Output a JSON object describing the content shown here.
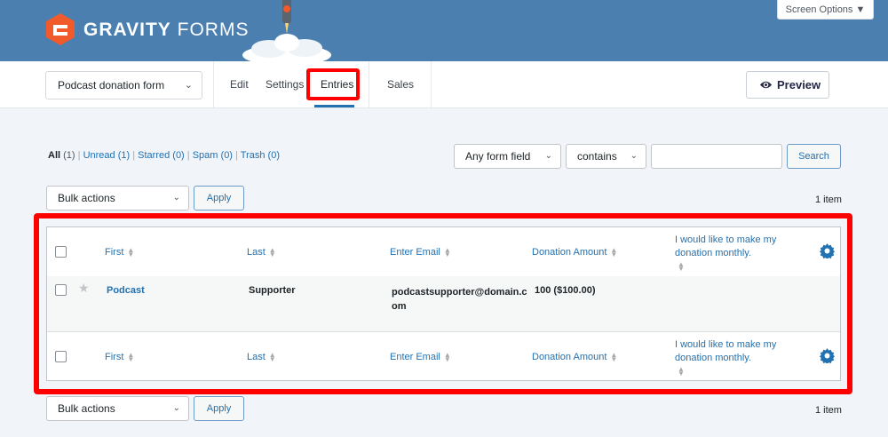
{
  "header": {
    "brand_bold": "GRAVITY",
    "brand_light": "FORMS",
    "screen_options": "Screen Options ▼"
  },
  "toolbar": {
    "form_select": "Podcast donation form",
    "nav": [
      "Edit",
      "Settings",
      "Entries",
      "Sales"
    ],
    "active_nav": "Entries",
    "preview_label": "Preview"
  },
  "filters": {
    "links": [
      {
        "label": "All",
        "count": "(1)"
      },
      {
        "label": "Unread",
        "count": "(1)"
      },
      {
        "label": "Starred",
        "count": "(0)"
      },
      {
        "label": "Spam",
        "count": "(0)"
      },
      {
        "label": "Trash",
        "count": "(0)"
      }
    ],
    "field_select": "Any form field",
    "operator_select": "contains",
    "search_value": "",
    "search_button": "Search"
  },
  "bulk": {
    "select_label": "Bulk actions",
    "apply_label": "Apply",
    "item_count": "1 item"
  },
  "table": {
    "columns": [
      "First",
      "Last",
      "Enter Email",
      "Donation Amount",
      "I would like to make my donation monthly."
    ],
    "rows": [
      {
        "first": "Podcast",
        "last": "Supporter",
        "email_line1": "podcastsupporter@domain.c",
        "email_line2": "om",
        "amount": "100 ($100.00)",
        "monthly": ""
      }
    ]
  },
  "colors": {
    "banner": "#4a7fb0",
    "link": "#2271b1",
    "highlight": "#ff0000"
  }
}
